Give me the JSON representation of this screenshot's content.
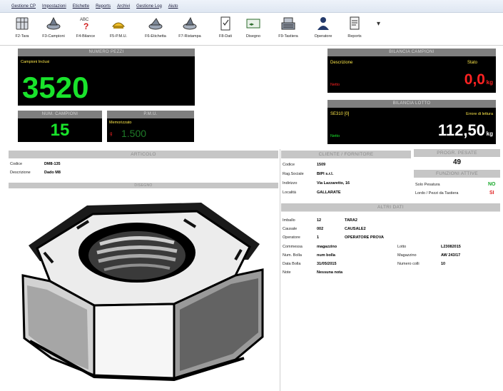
{
  "menu": [
    "Gestione CP",
    "Impostazioni",
    "Etichette",
    "Reports",
    "Archivi",
    "Gestione Log",
    "Aiuto"
  ],
  "toolbar": [
    {
      "label": "F2-Tara",
      "icon": "scale-tare-icon"
    },
    {
      "label": "F3-Campioni",
      "icon": "samples-icon"
    },
    {
      "label": "F4-Bilance",
      "icon": "balances-icon"
    },
    {
      "label": "F5-P.M.U.",
      "icon": "pmu-icon"
    },
    {
      "label": "F6-Etichetta",
      "icon": "label-icon"
    },
    {
      "label": "F7-Ristampa",
      "icon": "reprint-icon"
    },
    {
      "label": "F8-Dati",
      "icon": "data-icon"
    },
    {
      "label": "Disegno",
      "icon": "drawing-icon"
    },
    {
      "label": "F9-Tastiera",
      "icon": "keyboard-icon"
    },
    {
      "label": "Operatore",
      "icon": "operator-icon"
    },
    {
      "label": "Reports",
      "icon": "report-icon"
    }
  ],
  "numero_pezzi": {
    "title": "NUMERO PEZZI",
    "caption": "Campioni Inclusi",
    "value": "3520"
  },
  "num_campioni": {
    "title": "NUM. CAMPIONI",
    "value": "15"
  },
  "pmu": {
    "title": "P.M.U.",
    "caption": "Memorizzato",
    "prefix": "g",
    "value": "1.500"
  },
  "bilancia_campioni": {
    "title": "BILANCIA CAMPIONI",
    "desc_label": "Descrizione",
    "stato_label": "Stato",
    "status": "Netto",
    "value": "0,0",
    "unit": "kg"
  },
  "bilancia_lotto": {
    "title": "BILANCIA LOTTO",
    "scale_id": "SE310 [0]",
    "attesa": "Errore di lettura",
    "status": "Netto",
    "value": "112,50",
    "unit": "kg"
  },
  "articolo": {
    "title": "ARTICOLO",
    "codice_label": "Codice",
    "codice": "DM8-135",
    "descrizione_label": "Descrizione",
    "descrizione": "Dado M8",
    "disegno_title": "DISEGNO"
  },
  "cliente": {
    "title": "CLIENTE / FORNITORE",
    "rows": [
      {
        "label": "Codice",
        "value": "1509"
      },
      {
        "label": "Rag.Sociale",
        "value": "BIPI s.r.l."
      },
      {
        "label": "Indirizzo",
        "value": "Via Lazzaretto, 16"
      },
      {
        "label": "Località",
        "value": "GALLARATE"
      }
    ]
  },
  "progr": {
    "title": "PROGR. PESATE",
    "value": "49"
  },
  "funzioni": {
    "title": "FUNZIONI ATTIVE",
    "rows": [
      {
        "label": "Solo Pesatura",
        "value": "NO",
        "color": "#17a82a"
      },
      {
        "label": "Lordo / Pezzi da Tastiera",
        "value": "SI",
        "color": "#e02020"
      }
    ]
  },
  "altri_dati": {
    "title": "ALTRI DATI",
    "left": [
      {
        "label": "Imballo",
        "code": "12",
        "value": "TARA2"
      },
      {
        "label": "Causale",
        "code": "002",
        "value": "CAUSALE2"
      },
      {
        "label": "Operatore",
        "code": "1",
        "value": "OPERATORE PROVA"
      },
      {
        "label": "Commessa",
        "code": "",
        "value": "magazzino"
      },
      {
        "label": "Num. Bolla",
        "code": "",
        "value": "num bolla"
      },
      {
        "label": "Data Bolla",
        "code": "",
        "value": "31/05/2015"
      },
      {
        "label": "Note",
        "code": "",
        "value": "Nessuna nota"
      }
    ],
    "right": [
      {
        "label": "Lotto",
        "value": "L23082015"
      },
      {
        "label": "Magazzino",
        "value": "AW 243/17"
      },
      {
        "label": "Numero colli",
        "value": "10"
      }
    ]
  }
}
